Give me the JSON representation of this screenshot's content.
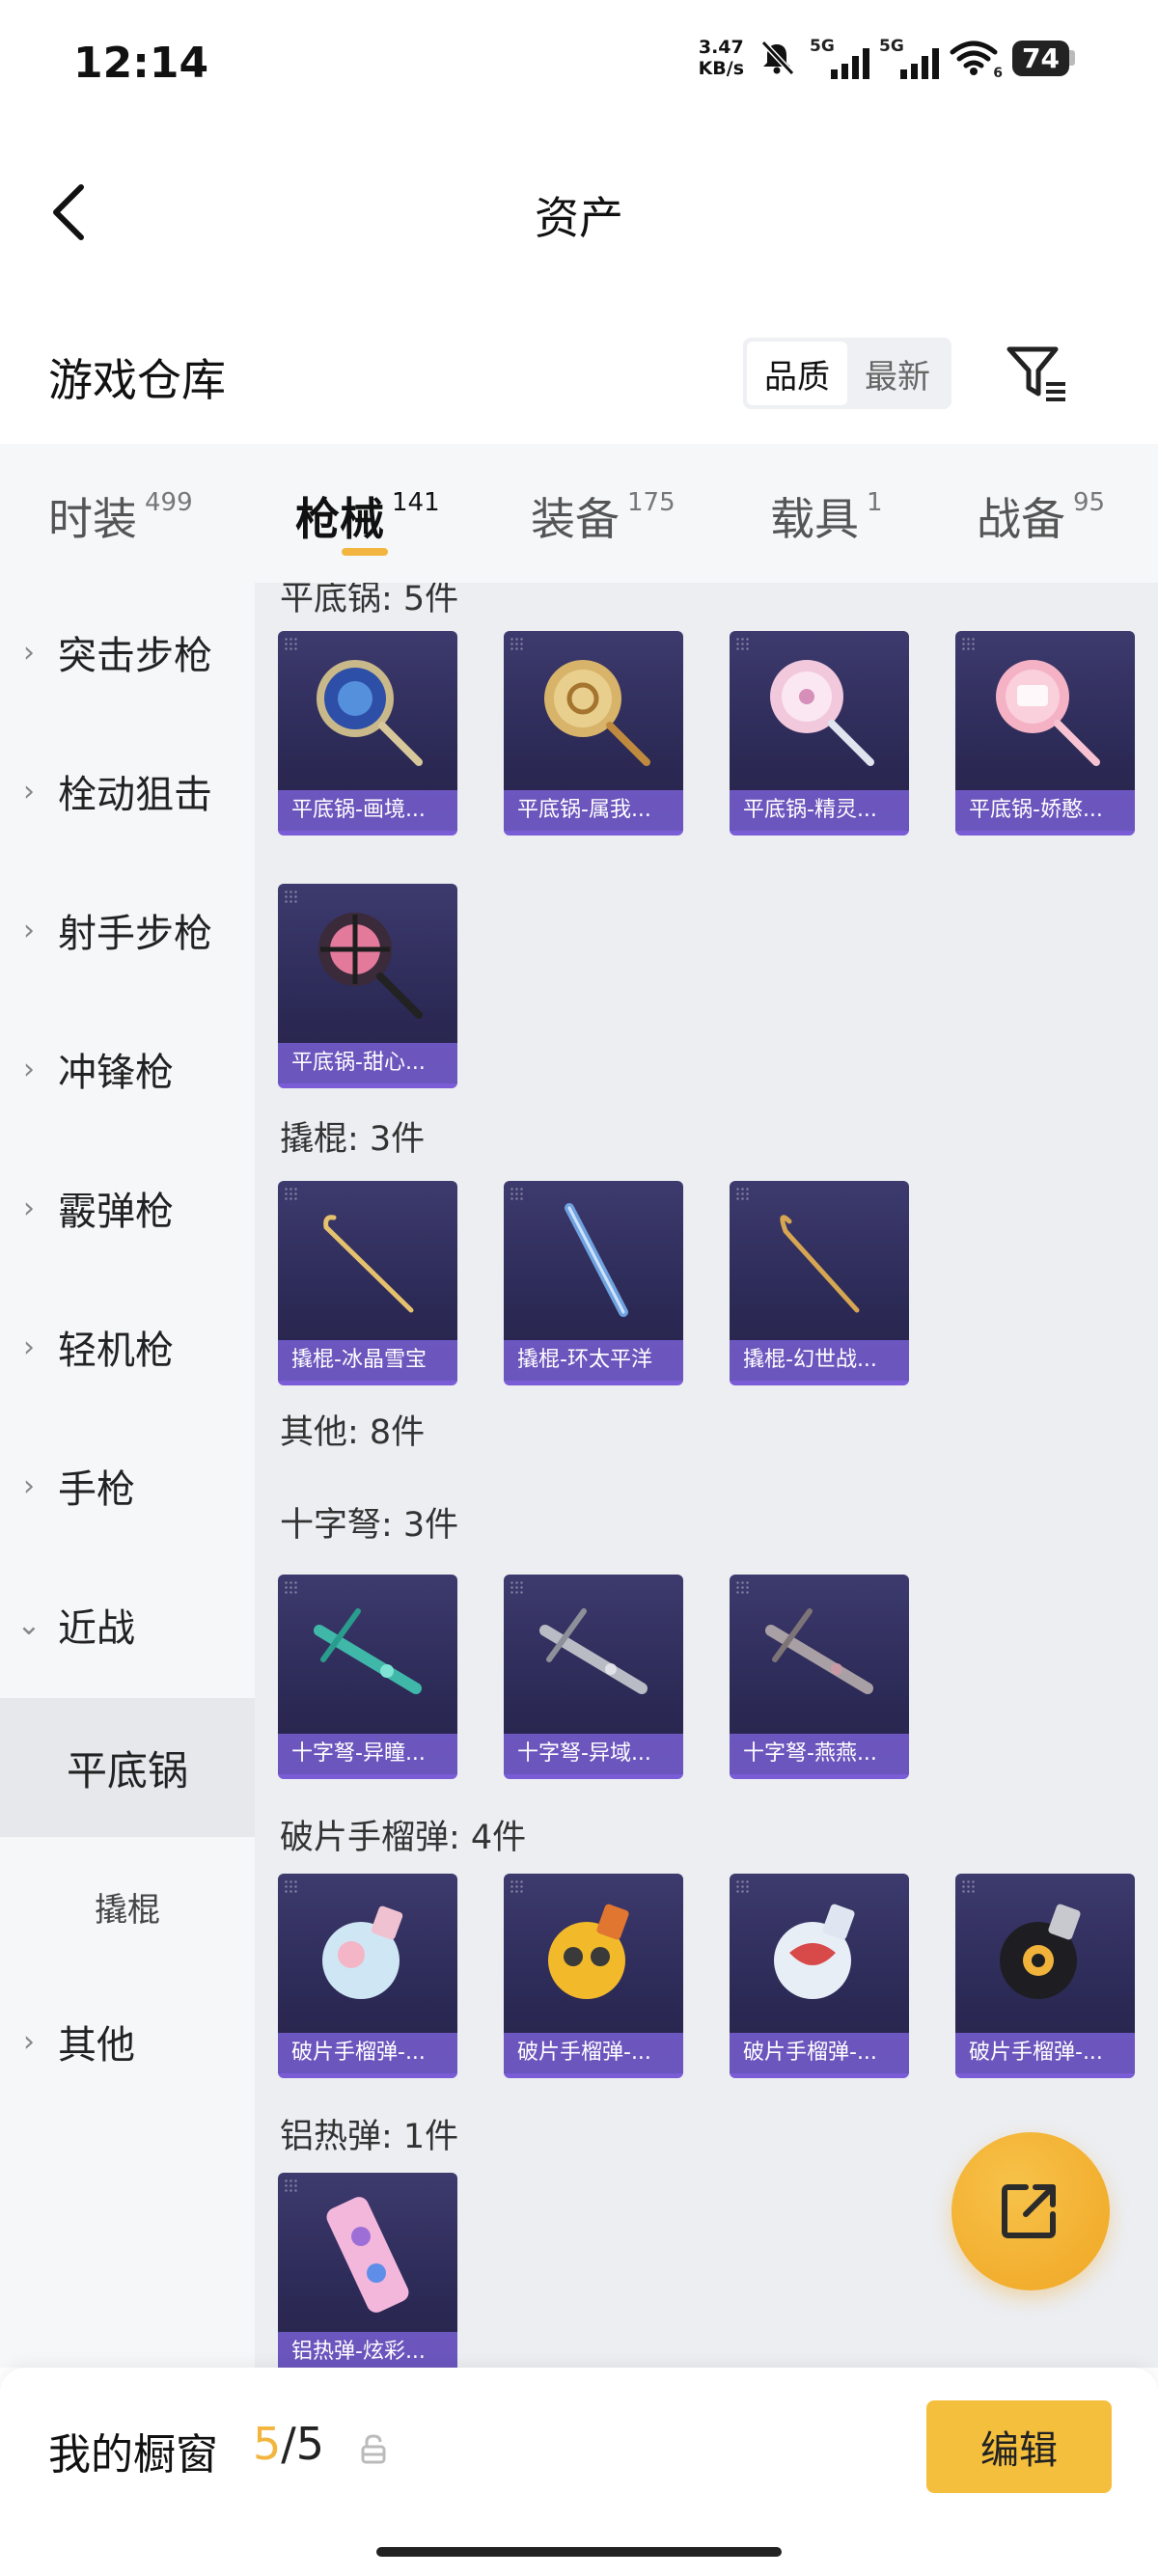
{
  "status_bar": {
    "time": "12:14",
    "net_speed_value": "3.47",
    "net_speed_unit": "KB/s",
    "signal_1_label": "5G",
    "signal_2_label": "5G",
    "wifi_label": "6",
    "battery": "74"
  },
  "header": {
    "title": "资产"
  },
  "warehouse": {
    "title": "游戏仓库",
    "sort_options": [
      "品质",
      "最新"
    ],
    "active_sort": "品质"
  },
  "tabs": [
    {
      "label": "时装",
      "count": "499"
    },
    {
      "label": "枪械",
      "count": "141"
    },
    {
      "label": "装备",
      "count": "175"
    },
    {
      "label": "载具",
      "count": "1"
    },
    {
      "label": "战备",
      "count": "95"
    }
  ],
  "sidebar": {
    "items": [
      "突击步枪",
      "栓动狙击",
      "射手步枪",
      "冲锋枪",
      "霰弹枪",
      "轻机枪",
      "手枪",
      "近战"
    ],
    "sub_items": [
      "平底锅",
      "撬棍"
    ],
    "last_item": "其他"
  },
  "content": {
    "cut_header": "平底锅: 5件",
    "pan_items": [
      "平底锅-画境...",
      "平底锅-属我...",
      "平底锅-精灵...",
      "平底锅-娇憨...",
      "平底锅-甜心..."
    ],
    "crowbar_header": "撬棍: 3件",
    "crowbar_items": [
      "撬棍-冰晶雪宝",
      "撬棍-环太平洋",
      "撬棍-幻世战..."
    ],
    "other_header": "其他: 8件",
    "crossbow_header": "十字弩: 3件",
    "crossbow_items": [
      "十字弩-异瞳...",
      "十字弩-异域...",
      "十字弩-燕燕..."
    ],
    "grenade_header": "破片手榴弹: 4件",
    "grenade_items": [
      "破片手榴弹-...",
      "破片手榴弹-...",
      "破片手榴弹-...",
      "破片手榴弹-..."
    ],
    "thermite_header": "铝热弹: 1件",
    "thermite_items": [
      "铝热弹-炫彩..."
    ]
  },
  "bottom_bar": {
    "title": "我的橱窗",
    "current": "5",
    "separator": "/",
    "total": "5",
    "edit_label": "编辑"
  },
  "colors": {
    "accent": "#f2b640",
    "card_bg": "#2c2a56",
    "card_label_bg": "#785fd2"
  }
}
